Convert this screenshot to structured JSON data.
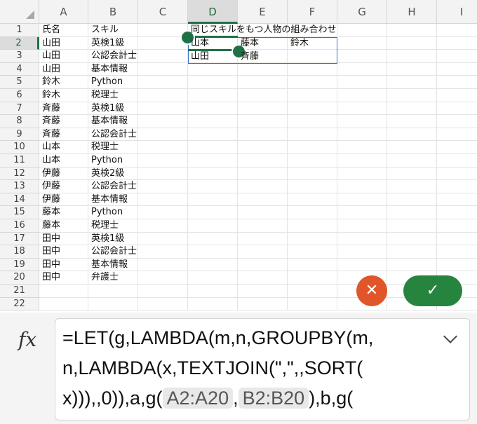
{
  "columns": [
    "A",
    "B",
    "C",
    "D",
    "E",
    "F",
    "G",
    "H",
    "I"
  ],
  "active_column": "D",
  "active_row": 2,
  "rows": [
    {
      "n": "1",
      "a": "氏名",
      "b": "スキル"
    },
    {
      "n": "2",
      "a": "山田",
      "b": "英検1級"
    },
    {
      "n": "3",
      "a": "山田",
      "b": "公認会計士"
    },
    {
      "n": "4",
      "a": "山田",
      "b": "基本情報"
    },
    {
      "n": "5",
      "a": "鈴木",
      "b": "Python"
    },
    {
      "n": "6",
      "a": "鈴木",
      "b": "税理士"
    },
    {
      "n": "7",
      "a": "斉藤",
      "b": "英検1級"
    },
    {
      "n": "8",
      "a": "斉藤",
      "b": "基本情報"
    },
    {
      "n": "9",
      "a": "斉藤",
      "b": "公認会計士"
    },
    {
      "n": "10",
      "a": "山本",
      "b": "税理士"
    },
    {
      "n": "11",
      "a": "山本",
      "b": "Python"
    },
    {
      "n": "12",
      "a": "伊藤",
      "b": "英検2級"
    },
    {
      "n": "13",
      "a": "伊藤",
      "b": "公認会計士"
    },
    {
      "n": "14",
      "a": "伊藤",
      "b": "基本情報"
    },
    {
      "n": "15",
      "a": "藤本",
      "b": "Python"
    },
    {
      "n": "16",
      "a": "藤本",
      "b": "税理士"
    },
    {
      "n": "17",
      "a": "田中",
      "b": "英検1級"
    },
    {
      "n": "18",
      "a": "田中",
      "b": "公認会計士"
    },
    {
      "n": "19",
      "a": "田中",
      "b": "基本情報"
    },
    {
      "n": "20",
      "a": "田中",
      "b": "弁護士"
    },
    {
      "n": "21",
      "a": "",
      "b": ""
    },
    {
      "n": "22",
      "a": "",
      "b": ""
    }
  ],
  "result": {
    "title": "同じスキルをもつ人物の組み合わせ",
    "d2": "山本",
    "e2": "藤本",
    "f2": "鈴木",
    "d3": "山田",
    "e3": "斉藤"
  },
  "buttons": {
    "cancel": "✕",
    "confirm": "✓"
  },
  "formula_bar": {
    "fx": "fx",
    "line1": "=LET(g,LAMBDA(m,n,GROUPBY(m,",
    "line2": "n,LAMBDA(x,TEXTJOIN(\",\",,SORT(",
    "line3_pre": "x))),,0)),a,g(",
    "ref1": "A2:A20",
    "sep": ",",
    "ref2": "B2:B20",
    "line3_post": "),b,g("
  }
}
